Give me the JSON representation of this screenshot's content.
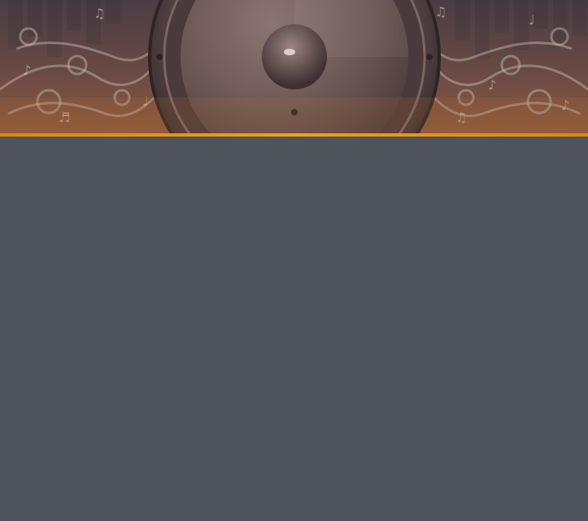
{
  "banner": {
    "art": "speaker-with-music-notes-swirls",
    "colors": {
      "top": "#4a3d44",
      "middle": "#6a4a45",
      "bottom": "#8b5a3d",
      "swirl": "#c8c0c0"
    }
  },
  "accent_bar": {
    "color": "#f2a20a"
  },
  "content": {
    "background": "#4f535a"
  }
}
